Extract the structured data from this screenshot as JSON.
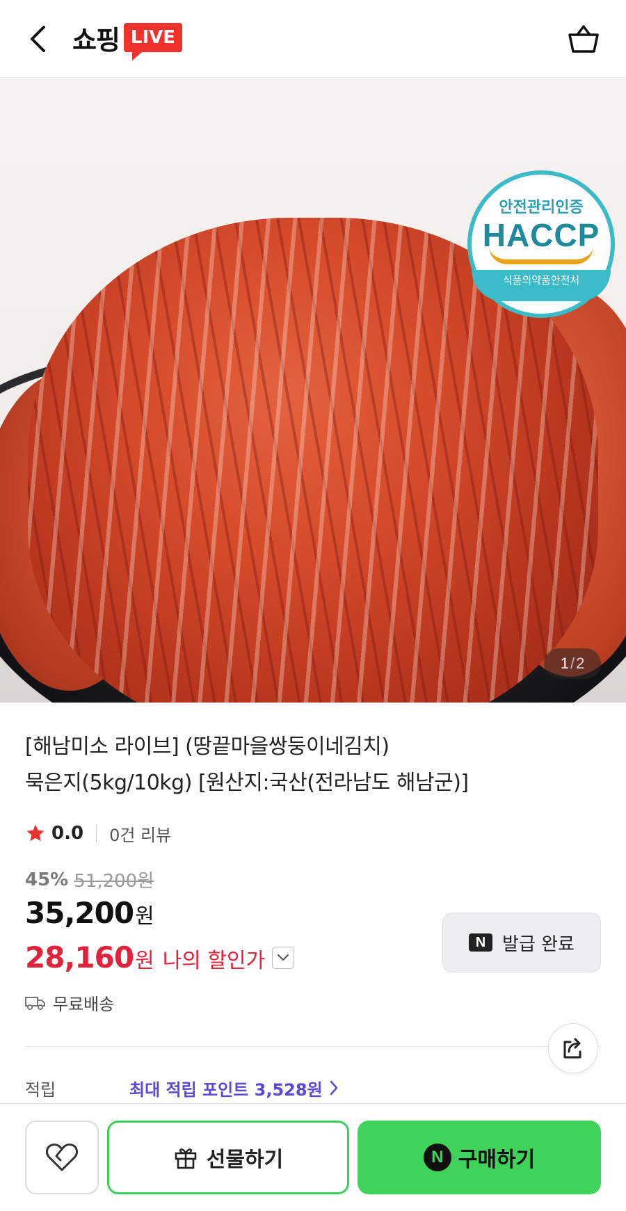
{
  "header": {
    "logo_text": "쇼핑",
    "logo_badge": "LIVE",
    "back_icon": "chevron-left-icon",
    "cart_icon": "shopping-basket-icon"
  },
  "image": {
    "counter_current": "1",
    "counter_separator": "/",
    "counter_total": "2",
    "haccp_top": "안전관리인증",
    "haccp_main": "HACCP",
    "haccp_bottom": "식품의약품안전처"
  },
  "product": {
    "title_line1": "[해남미소 라이브] (땅끝마을쌍둥이네김치)",
    "title_line2": "묵은지(5kg/10kg) [원산지:국산(전라남도 해남군)]",
    "rating": "0.0",
    "review_count": "0건 리뷰",
    "discount_rate": "45%",
    "original_price": "51,200원",
    "price": "35,200",
    "price_unit": "원",
    "my_price": "28,160",
    "my_price_unit": "원",
    "my_price_label": "나의 할인가",
    "coupon_badge": "N",
    "coupon_label": "발급 완료",
    "shipping": "무료배송"
  },
  "points": {
    "label": "적립",
    "value": "최대 적립 포인트 3,528원"
  },
  "bottom_bar": {
    "gift_label": "선물하기",
    "buy_badge": "N",
    "buy_label": "구매하기"
  },
  "colors": {
    "live_red": "#f0322d",
    "discount_red": "#e0223a",
    "points_purple": "#5b49d6",
    "naver_green": "#3fd35c",
    "haccp_teal": "#3bbac7"
  }
}
